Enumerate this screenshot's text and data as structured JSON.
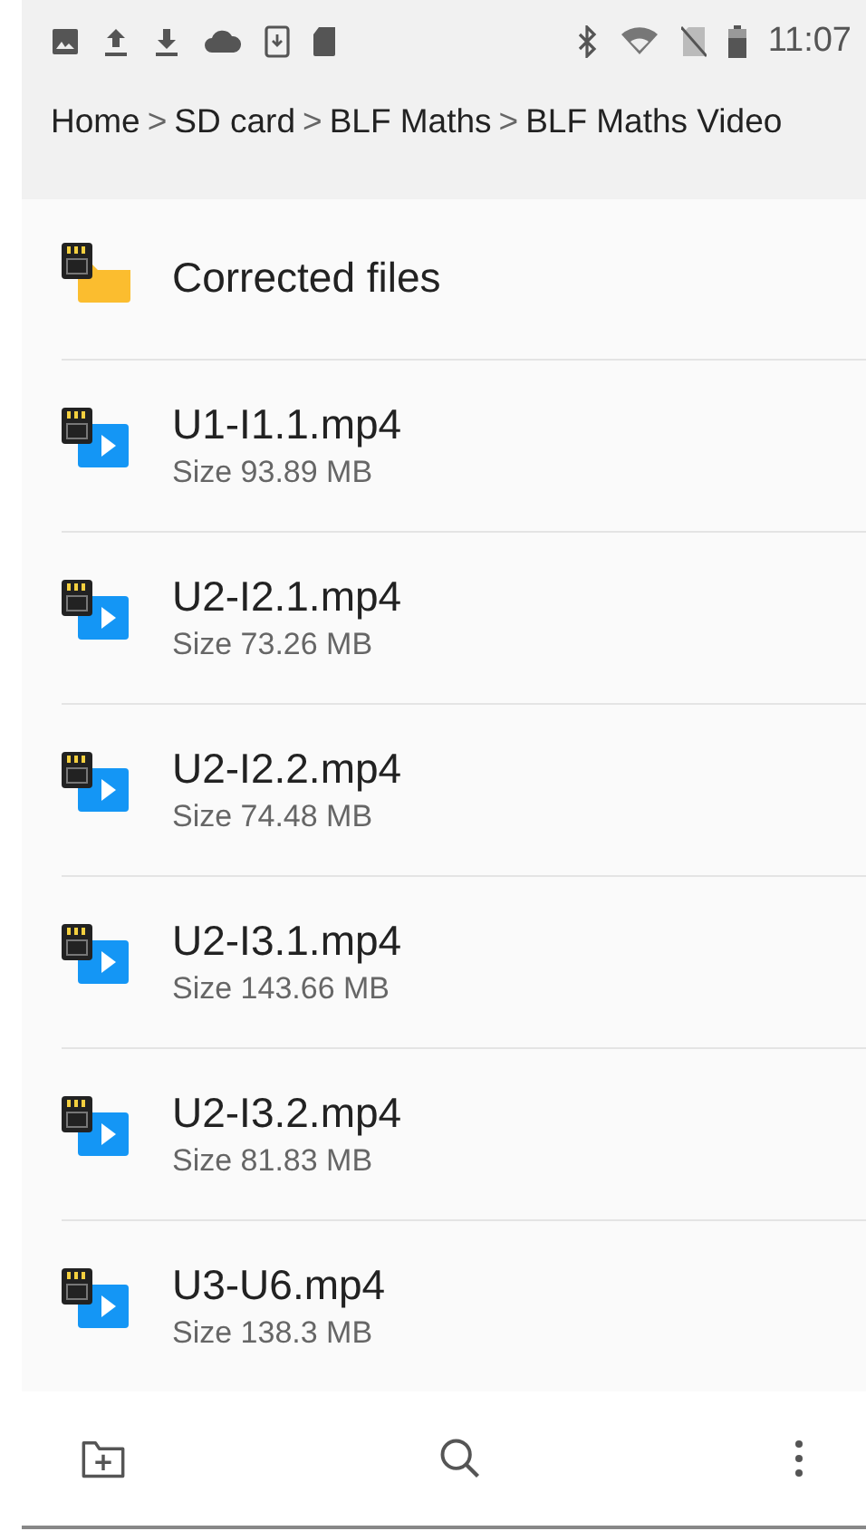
{
  "status_bar": {
    "time": "11:07"
  },
  "breadcrumb": [
    {
      "label": "Home",
      "separator": ">"
    },
    {
      "label": "SD card",
      "separator": ">"
    },
    {
      "label": "BLF Maths",
      "separator": ">"
    },
    {
      "label": "BLF Maths Video"
    }
  ],
  "items": [
    {
      "kind": "folder",
      "name": "Corrected files"
    },
    {
      "kind": "video",
      "name": "U1-I1.1.mp4",
      "size": "Size 93.89 MB"
    },
    {
      "kind": "video",
      "name": "U2-I2.1.mp4",
      "size": "Size 73.26 MB"
    },
    {
      "kind": "video",
      "name": "U2-I2.2.mp4",
      "size": "Size 74.48 MB"
    },
    {
      "kind": "video",
      "name": "U2-I3.1.mp4",
      "size": "Size 143.66 MB"
    },
    {
      "kind": "video",
      "name": "U2-I3.2.mp4",
      "size": "Size 81.83 MB"
    },
    {
      "kind": "video",
      "name": "U3-U6.mp4",
      "size": "Size 138.3 MB"
    }
  ]
}
